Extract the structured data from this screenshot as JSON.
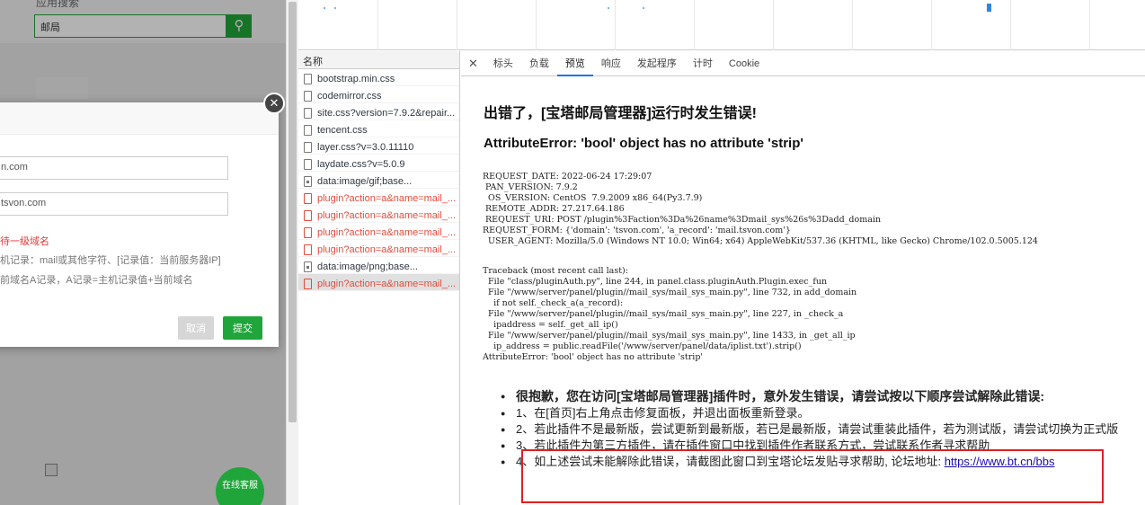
{
  "app": {
    "search_label": "应用搜索",
    "search_value": "邮局",
    "dialog": {
      "field1_value": "n.com",
      "field2_value": "tsvon.com",
      "hint_red": "待一级域名",
      "hint_line1": "机记录：mail或其他字符、[记录值：当前服务器IP]",
      "hint_line2": "前域名A记录，A记录=主机记录值+当前域名",
      "cancel_label": "取消",
      "submit_label": "提交",
      "close_glyph": "✕"
    },
    "online_service": "在线客服"
  },
  "devtools": {
    "list_header": "名称",
    "requests": [
      {
        "name": "bootstrap.min.css",
        "type": "css",
        "status": "ok"
      },
      {
        "name": "codemirror.css",
        "type": "css",
        "status": "ok"
      },
      {
        "name": "site.css?version=7.9.2&repair...",
        "type": "css",
        "status": "ok"
      },
      {
        "name": "tencent.css",
        "type": "css",
        "status": "ok"
      },
      {
        "name": "layer.css?v=3.0.11110",
        "type": "css",
        "status": "ok"
      },
      {
        "name": "laydate.css?v=5.0.9",
        "type": "css",
        "status": "ok"
      },
      {
        "name": "data:image/gif;base...",
        "type": "image",
        "status": "ok"
      },
      {
        "name": "plugin?action=a&name=mail_...",
        "type": "xhr",
        "status": "error"
      },
      {
        "name": "plugin?action=a&name=mail_...",
        "type": "xhr",
        "status": "error"
      },
      {
        "name": "plugin?action=a&name=mail_...",
        "type": "xhr",
        "status": "error"
      },
      {
        "name": "plugin?action=a&name=mail_...",
        "type": "xhr",
        "status": "error"
      },
      {
        "name": "data:image/png;base...",
        "type": "image",
        "status": "ok"
      },
      {
        "name": "plugin?action=a&name=mail_...",
        "type": "xhr",
        "status": "error",
        "selected": true
      }
    ],
    "tabs": [
      "标头",
      "负载",
      "预览",
      "响应",
      "发起程序",
      "计时",
      "Cookie"
    ],
    "active_tab": "预览",
    "accent_color": "#1a73e8",
    "error_color": "#e34c3c"
  },
  "preview": {
    "title": "出错了，[宝塔邮局管理器]运行时发生错误!",
    "error_line": "AttributeError: 'bool' object has no attribute 'strip'",
    "request_info": "REQUEST_DATE: 2022-06-24 17:29:07\n PAN_VERSION: 7.9.2\n  OS_VERSION: CentOS  7.9.2009 x86_64(Py3.7.9)\n REMOTE_ADDR: 27.217.64.186\n REQUEST_URI: POST /plugin%3Faction%3Da%26name%3Dmail_sys%26s%3Dadd_domain\nREQUEST_FORM: {'domain': 'tsvon.com', 'a_record': 'mail.tsvon.com'}\n  USER_AGENT: Mozilla/5.0 (Windows NT 10.0; Win64; x64) AppleWebKit/537.36 (KHTML, like Gecko) Chrome/102.0.5005.124",
    "traceback": "Traceback (most recent call last):\n  File \"class/pluginAuth.py\", line 244, in panel.class.pluginAuth.Plugin.exec_fun\n  File \"/www/server/panel/plugin//mail_sys/mail_sys_main.py\", line 732, in add_domain\n    if not self._check_a(a_record):\n  File \"/www/server/panel/plugin//mail_sys/mail_sys_main.py\", line 227, in _check_a\n    ipaddress = self._get_all_ip()\n  File \"/www/server/panel/plugin//mail_sys/mail_sys_main.py\", line 1433, in _get_all_ip\n    ip_address = public.readFile('/www/server/panel/data/iplist.txt').strip()\nAttributeError: 'bool' object has no attribute 'strip'",
    "help_lead": "很抱歉，您在访问[宝塔邮局管理器]插件时，意外发生错误，请尝试按以下顺序尝试解除此错误:",
    "help_1": "1、在[首页]右上角点击修复面板，并退出面板重新登录。",
    "help_2": "2、若此插件不是最新版，尝试更新到最新版，若已是最新版，请尝试重装此插件，若为测试版，请尝试切换为正式版",
    "help_3": "3、若此插件为第三方插件，请在插件窗口中找到插件作者联系方式，尝试联系作者寻求帮助",
    "help_4_text": "4、如上述尝试未能解除此错误，请截图此窗口到宝塔论坛发贴寻求帮助, 论坛地址: ",
    "help_4_link": "https://www.bt.cn/bbs"
  }
}
